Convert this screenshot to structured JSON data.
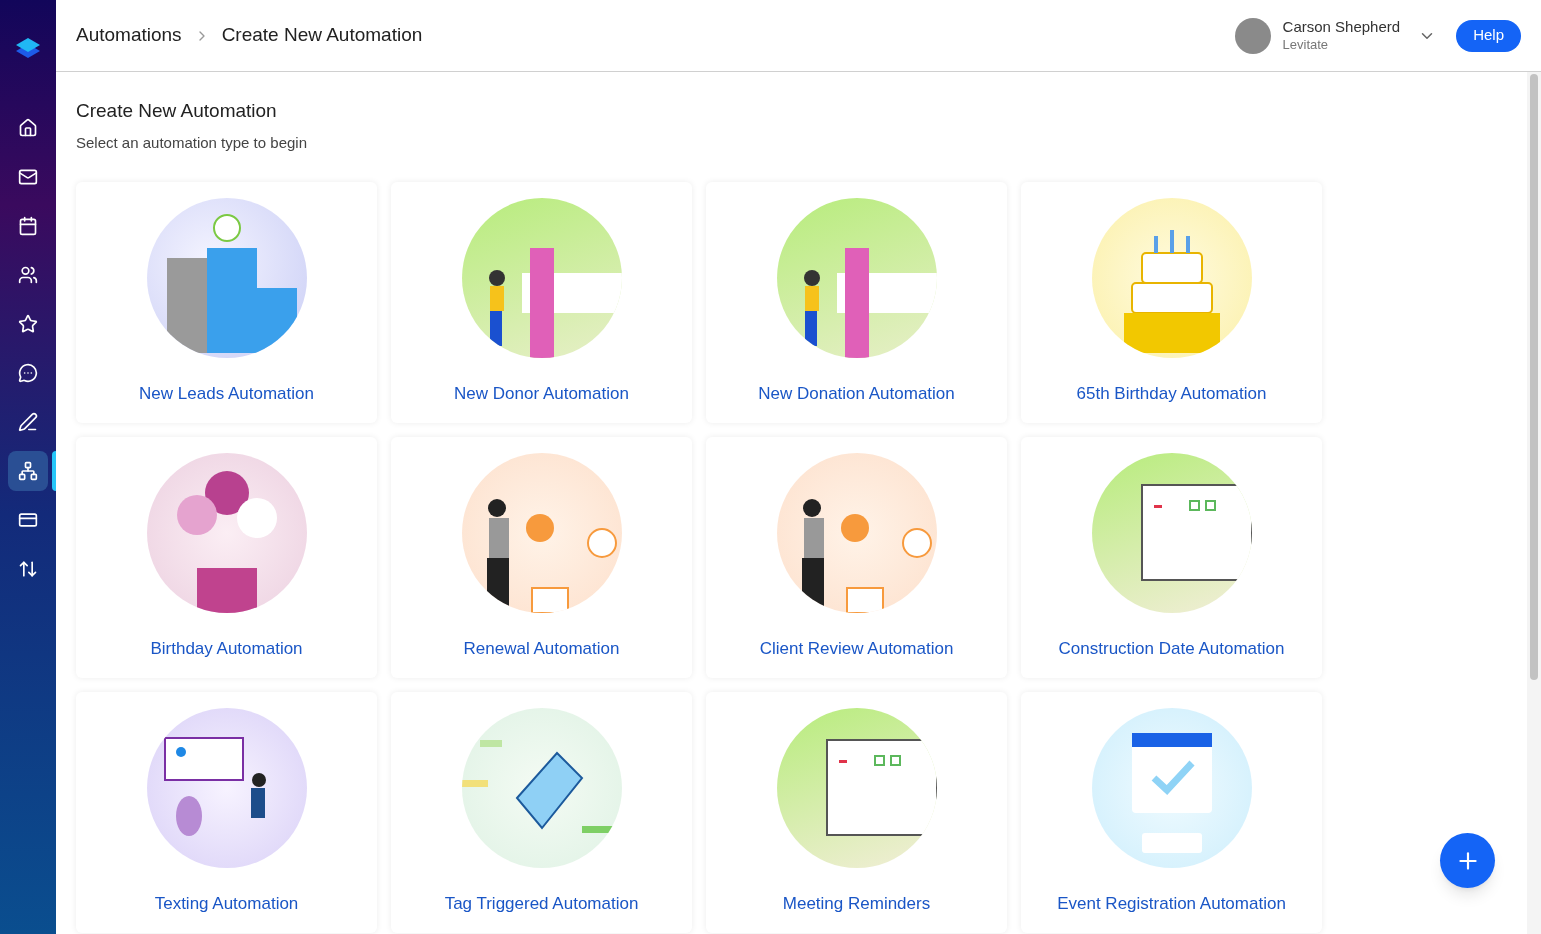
{
  "sidebar": {
    "items": [
      {
        "selected": false
      },
      {
        "selected": false
      },
      {
        "selected": false
      },
      {
        "selected": false
      },
      {
        "selected": false
      },
      {
        "selected": false
      },
      {
        "selected": false
      },
      {
        "selected": true
      },
      {
        "selected": false
      },
      {
        "selected": false
      }
    ]
  },
  "breadcrumb": [
    "Automations",
    "Create New Automation"
  ],
  "user": {
    "name": "Carson Shepherd",
    "org": "Levitate"
  },
  "help_button": "Help",
  "heading": "Create New Automation",
  "subheading": "Select an automation type to begin",
  "cards": [
    {
      "label": "New Leads Automation"
    },
    {
      "label": "New Donor Automation"
    },
    {
      "label": "New Donation Automation"
    },
    {
      "label": "65th Birthday Automation"
    },
    {
      "label": "Birthday Automation"
    },
    {
      "label": "Renewal Automation"
    },
    {
      "label": "Client Review Automation"
    },
    {
      "label": "Construction Date Automation"
    },
    {
      "label": "Texting Automation"
    },
    {
      "label": "Tag Triggered Automation"
    },
    {
      "label": "Meeting Reminders"
    },
    {
      "label": "Event Registration Automation"
    }
  ]
}
